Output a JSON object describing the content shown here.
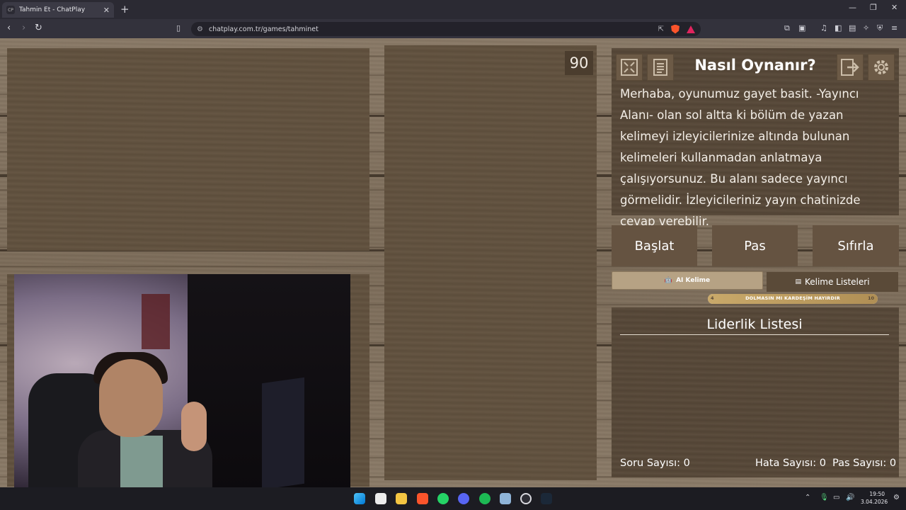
{
  "browser": {
    "tab_favicon": "CP",
    "tab_title": "Tahmin Et - ChatPlay",
    "url": "chatplay.com.tr/games/tahminet"
  },
  "game": {
    "timer": "90",
    "how_to_play": {
      "title": "Nasıl Oynanır?",
      "text": "Merhaba, oyunumuz gayet basit. -Yayıncı Alanı- olan sol altta ki bölüm de yazan kelimeyi izleyicilerinize altında bulunan kelimeleri kullanmadan anlatmaya çalışıyorsunuz. Bu alanı sadece yayıncı görmelidir. İzleyicileriniz yayın chatinizde cevap verebilir."
    },
    "controls": {
      "start": "Başlat",
      "pass": "Pas",
      "reset": "Sıfırla"
    },
    "ai_word_label": "AI Kelime",
    "word_lists_label": "Kelime Listeleri",
    "slider": {
      "min": "4",
      "max": "10",
      "label": "DOLMASIN MI KARDEŞİM HAYIRDIR",
      "fill_fraction": 1.0
    },
    "leaderboard_title": "Liderlik Listesi",
    "stats": {
      "questions": "Soru Sayısı: 0",
      "errors": "Hata Sayısı: 0",
      "passes": "Pas Sayısı: 0"
    }
  },
  "taskbar": {
    "time": "19:50",
    "date": "3.04.2026"
  },
  "icons": {
    "fullscreen": "fullscreen-icon",
    "rules": "document-icon",
    "exit": "exit-icon",
    "settings": "gear-icon"
  }
}
